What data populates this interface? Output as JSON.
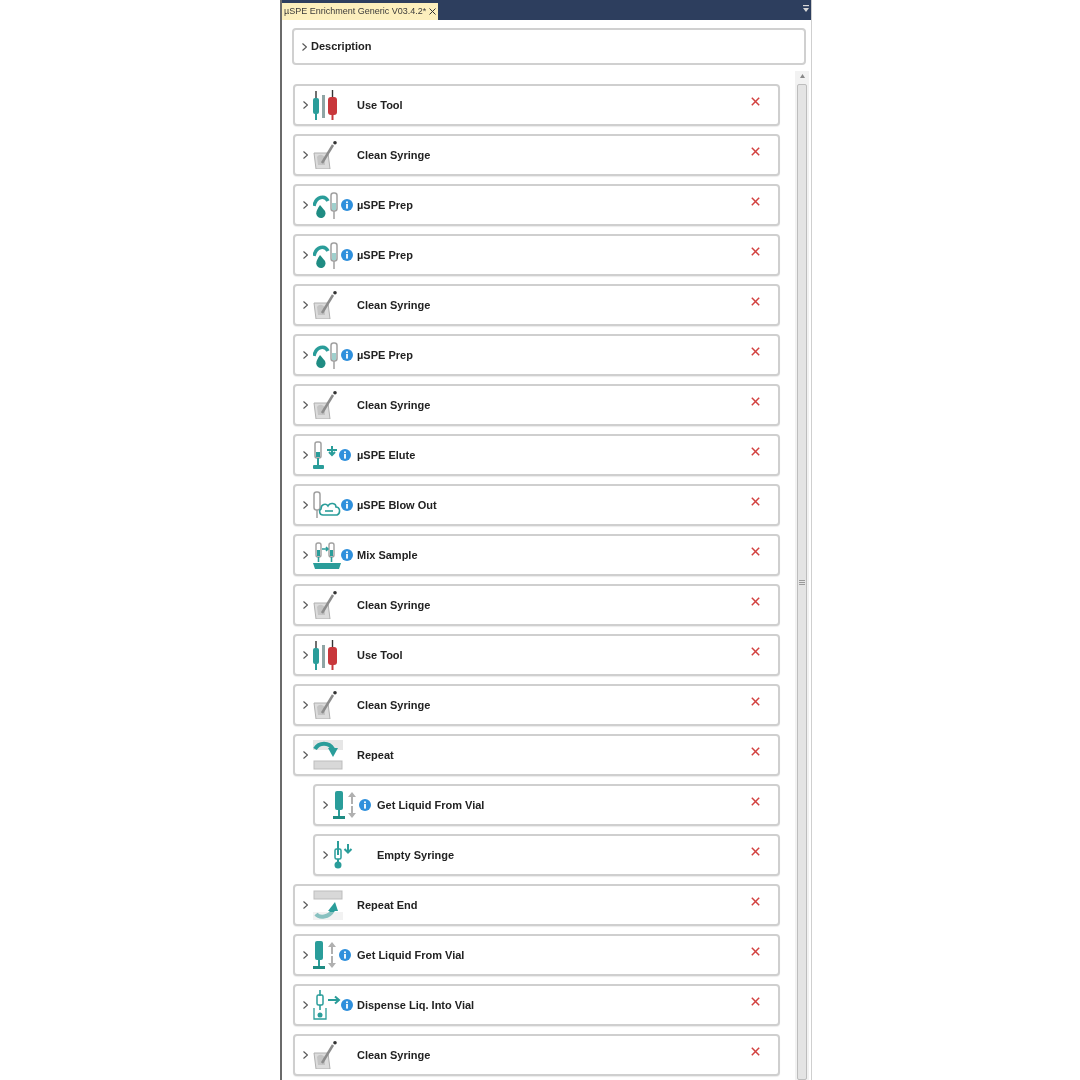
{
  "tabs": [
    {
      "label": "µSPE Enrichment Generic V03.4.2*",
      "selected": true
    }
  ],
  "description": {
    "label": "Description",
    "expanded": false
  },
  "steps": [
    {
      "kind": "use_tool",
      "label": "Use Tool",
      "info": false,
      "expanded": false
    },
    {
      "kind": "clean_syringe",
      "label": "Clean Syringe",
      "info": false,
      "expanded": false
    },
    {
      "kind": "spe_prep",
      "label": "µSPE Prep",
      "info": true,
      "expanded": false
    },
    {
      "kind": "spe_prep",
      "label": "µSPE Prep",
      "info": true,
      "expanded": false
    },
    {
      "kind": "clean_syringe",
      "label": "Clean Syringe",
      "info": false,
      "expanded": false
    },
    {
      "kind": "spe_prep",
      "label": "µSPE Prep",
      "info": true,
      "expanded": false
    },
    {
      "kind": "clean_syringe",
      "label": "Clean Syringe",
      "info": false,
      "expanded": false
    },
    {
      "kind": "spe_elute",
      "label": "µSPE Elute",
      "info": true,
      "expanded": false
    },
    {
      "kind": "spe_blow_out",
      "label": "µSPE Blow Out",
      "info": true,
      "expanded": false
    },
    {
      "kind": "mix_sample",
      "label": "Mix Sample",
      "info": true,
      "expanded": false
    },
    {
      "kind": "clean_syringe",
      "label": "Clean Syringe",
      "info": false,
      "expanded": false
    },
    {
      "kind": "use_tool",
      "label": "Use Tool",
      "info": false,
      "expanded": false
    },
    {
      "kind": "clean_syringe",
      "label": "Clean Syringe",
      "info": false,
      "expanded": false
    },
    {
      "kind": "repeat",
      "label": "Repeat",
      "info": false,
      "expanded": false,
      "children": [
        {
          "kind": "get_liquid",
          "label": "Get Liquid From Vial",
          "info": true,
          "expanded": false
        },
        {
          "kind": "empty_syringe",
          "label": "Empty Syringe",
          "info": false,
          "expanded": false
        }
      ]
    },
    {
      "kind": "repeat_end",
      "label": "Repeat End",
      "info": false,
      "expanded": false
    },
    {
      "kind": "get_liquid",
      "label": "Get Liquid From Vial",
      "info": true,
      "expanded": false
    },
    {
      "kind": "dispense",
      "label": "Dispense Liq. Into Vial",
      "info": true,
      "expanded": false
    },
    {
      "kind": "clean_syringe",
      "label": "Clean Syringe",
      "info": false,
      "expanded": false
    }
  ]
}
